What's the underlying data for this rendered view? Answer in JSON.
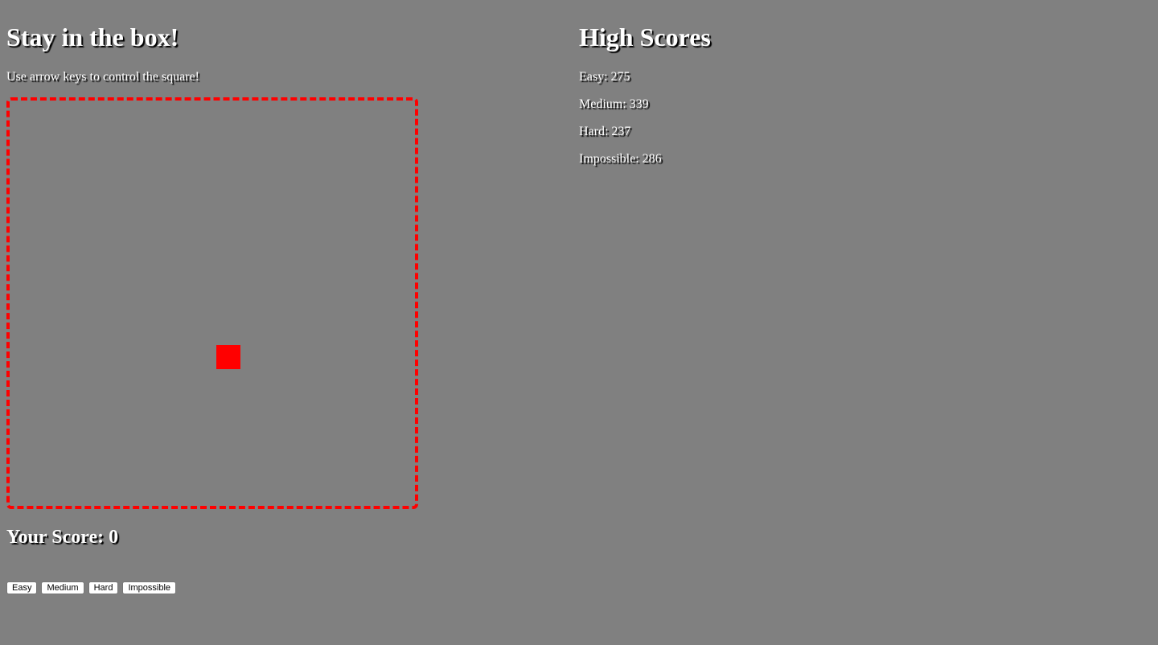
{
  "game": {
    "title": "Stay in the box!",
    "instructions": "Use arrow keys to control the square!",
    "score_label": "Your Score: 0",
    "box_color": "#ff0000",
    "player_color": "#ff0000",
    "background_color": "#808080"
  },
  "difficulty_buttons": [
    {
      "label": "Easy"
    },
    {
      "label": "Medium"
    },
    {
      "label": "Hard"
    },
    {
      "label": "Impossible"
    }
  ],
  "high_scores": {
    "title": "High Scores",
    "entries": [
      {
        "text": "Easy: 275"
      },
      {
        "text": "Medium: 339"
      },
      {
        "text": "Hard: 237"
      },
      {
        "text": "Impossible: 286"
      }
    ]
  }
}
